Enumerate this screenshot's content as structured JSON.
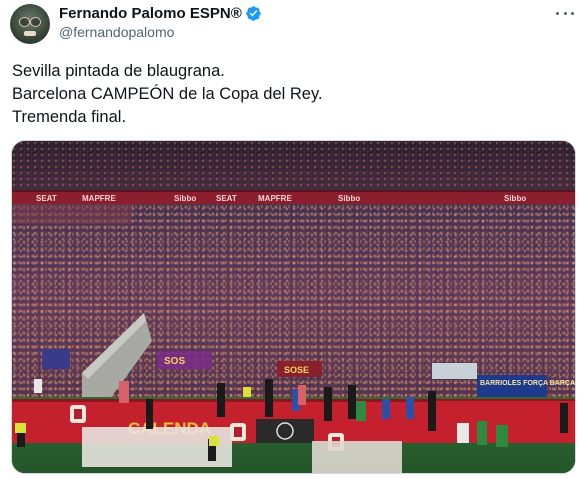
{
  "author": {
    "display_name": "Fernando Palomo ESPN®",
    "handle": "@fernandopalomo",
    "verified": true
  },
  "tweet": {
    "lines": [
      "Sevilla pintada de blaugrana.",
      "Barcelona CAMPEÓN de la Copa del Rey.",
      "Tremenda final."
    ]
  },
  "icons": {
    "more": "more-horizontal-icon",
    "verified": "verified-badge-icon"
  },
  "colors": {
    "verified_blue": "#1d9bf0",
    "text_primary": "#0f1419",
    "text_secondary": "#536471"
  },
  "media": {
    "banner_texts": [
      "SEAT",
      "MAPFRE",
      "Sibbo",
      "SEAT",
      "MAPFRE",
      "Sibbo",
      "Sibbo"
    ],
    "board_texts": [
      "CALENDA",
      "BARRIOLES FORÇA BARÇA",
      "SOSE"
    ]
  }
}
